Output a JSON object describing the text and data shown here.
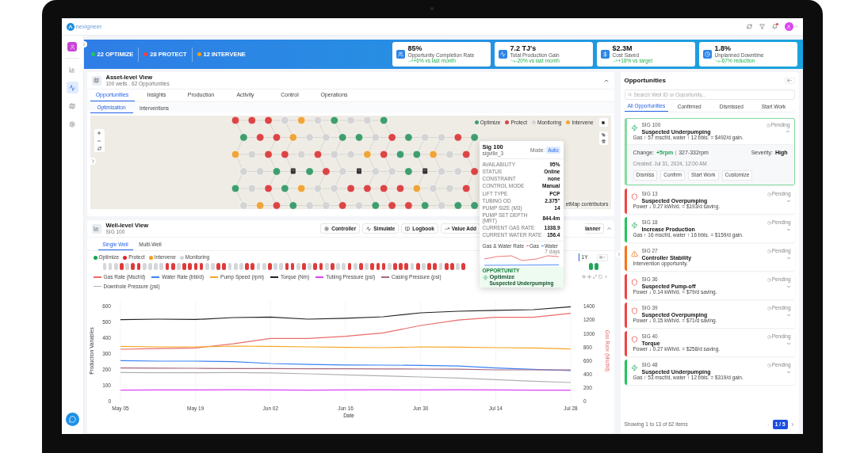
{
  "header": {
    "logo": "nexigneer",
    "unread": true
  },
  "sidebar": {
    "items": [
      {
        "selected": false
      },
      {
        "selected": true
      },
      {
        "selected": false
      },
      {
        "selected": false
      }
    ]
  },
  "banner": {
    "counts": [
      {
        "label": "22 OPTIMIZE",
        "color": "#22c55e"
      },
      {
        "label": "28 PROTECT",
        "color": "#ef4444"
      },
      {
        "label": "12 INTERVENE",
        "color": "#f59e0b"
      }
    ],
    "kpis": [
      {
        "value": "85%",
        "label": "Opportunity Completion Rate",
        "trend": "+6% vs last month",
        "rising": true
      },
      {
        "value": "7.2 TJ's",
        "label": "Total Production Gain",
        "trend": "-20% vs last month",
        "rising": false
      },
      {
        "value": "$2.3M",
        "label": "Cost Saved",
        "trend": "+18% vs target",
        "rising": true
      },
      {
        "value": "1.8%",
        "label": "Unplanned Downtime",
        "trend": "-67% reduction",
        "rising": false
      }
    ]
  },
  "asset_view": {
    "title": "Asset-level View",
    "subtitle": "100 wells . 62 Opportunities",
    "expanded": true,
    "tabs": [
      {
        "label": "Opportunities",
        "selected": true
      },
      {
        "label": "Insights",
        "selected": false
      },
      {
        "label": "Production",
        "selected": false
      },
      {
        "label": "Activity",
        "selected": false
      },
      {
        "label": "Control",
        "selected": false
      },
      {
        "label": "Operations",
        "selected": false
      }
    ],
    "subtabs": [
      {
        "label": "Optimisation",
        "selected": true
      },
      {
        "label": "Interventions",
        "selected": false
      }
    ],
    "map": {
      "legend": [
        {
          "label": "Optimize",
          "color": "#3f9e6e"
        },
        {
          "label": "Protect",
          "color": "#dc4545"
        },
        {
          "label": "Monitoring",
          "color": "#d4d4d4"
        },
        {
          "label": "Intervene",
          "color": "#f0a53a"
        }
      ],
      "rows": [
        {
          "nodes": [
            {
              "kind": "protect"
            },
            {
              "kind": "protect"
            },
            {
              "kind": "protect"
            },
            {
              "kind": "monitoring"
            },
            {
              "kind": "intervene"
            },
            {
              "kind": "monitoring"
            },
            {
              "kind": "optimize"
            },
            {
              "kind": "monitoring"
            },
            {
              "kind": "monitoring"
            },
            {
              "kind": "optimize"
            }
          ]
        },
        {
          "nodes": [
            {
              "kind": "optimize"
            },
            {
              "kind": "protect"
            },
            {
              "kind": "protect"
            },
            {
              "kind": "intervene"
            },
            {
              "kind": "monitoring"
            },
            {
              "kind": "monitoring"
            },
            {
              "kind": "optimize"
            },
            {
              "kind": "optimize"
            },
            {
              "kind": "monitoring"
            },
            {
              "kind": "protect"
            },
            {
              "kind": "optimize"
            },
            {
              "kind": "monitoring"
            },
            {
              "kind": "monitoring"
            },
            {
              "kind": "protect"
            },
            {
              "kind": "optimize"
            }
          ]
        },
        {
          "nodes": [
            {
              "kind": "intervene"
            },
            {
              "kind": "monitoring"
            },
            {
              "kind": "protect"
            },
            {
              "kind": "protect"
            },
            {
              "kind": "monitoring"
            },
            {
              "kind": "protect"
            },
            {
              "kind": "monitoring"
            },
            {
              "kind": "monitoring"
            },
            {
              "kind": "intervene"
            },
            {
              "kind": "protect"
            },
            {
              "kind": "optimize"
            },
            {
              "kind": "optimize"
            },
            {
              "kind": "intervene"
            },
            {
              "kind": "monitoring"
            },
            {
              "kind": "protect"
            }
          ]
        },
        {
          "nodes": [
            {
              "kind": "monitoring"
            },
            {
              "kind": "monitoring"
            },
            {
              "kind": "optimize"
            },
            {
              "kind": "pump"
            },
            {
              "kind": "optimize"
            },
            {
              "kind": "protect"
            },
            {
              "kind": "monitoring"
            },
            {
              "kind": "pump"
            },
            {
              "kind": "monitoring"
            },
            {
              "kind": "monitoring"
            },
            {
              "kind": "optimize"
            },
            {
              "kind": "pump"
            },
            {
              "kind": "monitoring"
            },
            {
              "kind": "monitoring"
            },
            {
              "kind": "protect"
            }
          ]
        },
        {
          "nodes": [
            {
              "kind": "optimize"
            },
            {
              "kind": "monitoring"
            },
            {
              "kind": "protect"
            },
            {
              "kind": "optimize"
            },
            {
              "kind": "intervene"
            },
            {
              "kind": "monitoring"
            },
            {
              "kind": "monitoring"
            },
            {
              "kind": "protect"
            },
            {
              "kind": "protect"
            },
            {
              "kind": "protect"
            },
            {
              "kind": "protect"
            },
            {
              "kind": "intervene"
            },
            {
              "kind": "monitoring"
            },
            {
              "kind": "monitoring"
            },
            {
              "kind": "protect"
            }
          ]
        },
        {
          "nodes": [
            {
              "kind": "monitoring"
            },
            {
              "kind": "intervene"
            },
            {
              "kind": "protect"
            },
            {
              "kind": "optimize"
            },
            {
              "kind": "monitoring"
            },
            {
              "kind": "monitoring"
            },
            {
              "kind": "protect"
            },
            {
              "kind": "monitoring"
            },
            {
              "kind": "optimize"
            },
            {
              "kind": "protect"
            },
            {
              "kind": "protect"
            },
            {
              "kind": "optimize"
            },
            {
              "kind": "monitoring"
            },
            {
              "kind": "optimize"
            },
            {
              "kind": "optimize"
            }
          ]
        }
      ],
      "attribution": "etMap contributors"
    }
  },
  "well_view": {
    "title": "Well-level View",
    "subtitle": "SIG 100",
    "expanded": true,
    "actions": [
      "Controller",
      "Simulate",
      "Logbook",
      "Value Add"
    ],
    "cut_action": "lanner",
    "tabs": [
      {
        "label": "Single Well",
        "selected": true
      },
      {
        "label": "Multi-Well",
        "selected": false
      }
    ],
    "status_legend": [
      {
        "label": "Optimize",
        "color": "#16a34a"
      },
      {
        "label": "Protect",
        "color": "#dc2626"
      },
      {
        "label": "Intervene",
        "color": "#f59e0b"
      },
      {
        "label": "Monitoring",
        "color": "#d1d5db"
      }
    ],
    "range": "1Y",
    "pills": [
      {
        "kind": "monitoring"
      },
      {
        "kind": "monitoring"
      },
      {
        "kind": "monitoring"
      },
      {
        "kind": "protect"
      },
      {
        "kind": "monitoring"
      },
      {
        "kind": "protect"
      },
      {
        "kind": "protect"
      },
      {
        "kind": "monitoring"
      },
      {
        "kind": "monitoring"
      },
      {
        "kind": "monitoring"
      },
      {
        "kind": "monitoring"
      },
      {
        "kind": "protect"
      },
      {
        "kind": "protect"
      },
      {
        "kind": "monitoring"
      },
      {
        "kind": "protect"
      },
      {
        "kind": "protect"
      },
      {
        "kind": "protect"
      },
      {
        "kind": "protect"
      },
      {
        "kind": "monitoring"
      },
      {
        "kind": "monitoring"
      },
      {
        "kind": "protect"
      },
      {
        "kind": "protect"
      },
      {
        "kind": "monitoring"
      },
      {
        "kind": "monitoring"
      },
      {
        "kind": "monitoring"
      },
      {
        "kind": "protect"
      },
      {
        "kind": "protect"
      },
      {
        "kind": "monitoring"
      },
      {
        "kind": "monitoring"
      },
      {
        "kind": "protect"
      },
      {
        "kind": "monitoring"
      },
      {
        "kind": "monitoring"
      },
      {
        "kind": "protect"
      },
      {
        "kind": "protect"
      },
      {
        "kind": "monitoring"
      },
      {
        "kind": "protect"
      },
      {
        "kind": "monitoring"
      },
      {
        "kind": "protect"
      },
      {
        "kind": "protect"
      },
      {
        "kind": "monitoring"
      },
      {
        "kind": "protect"
      },
      {
        "kind": "monitoring"
      },
      {
        "kind": "monitoring"
      },
      {
        "kind": "protect"
      },
      {
        "kind": "monitoring"
      },
      {
        "kind": "protect"
      },
      {
        "kind": "monitoring"
      },
      {
        "kind": "protect"
      },
      {
        "kind": "protect"
      },
      {
        "kind": "protect"
      },
      {
        "kind": "monitoring"
      },
      {
        "kind": "protect"
      },
      {
        "kind": "protect"
      },
      {
        "kind": "protect"
      },
      {
        "kind": "monitoring"
      },
      {
        "kind": "protect"
      },
      {
        "kind": "monitoring"
      },
      {
        "kind": "protect"
      },
      {
        "kind": "protect"
      },
      {
        "kind": "monitoring"
      },
      {
        "kind": "protect"
      },
      {
        "kind": "protect"
      },
      {
        "kind": "monitoring"
      },
      {
        "kind": "protect"
      }
    ],
    "pills_after": [
      {
        "kind": "optimize"
      },
      {
        "kind": "optimize"
      }
    ],
    "chart_data": {
      "type": "line",
      "grid": true,
      "xlabel": "Date",
      "ylabel": "Production Variables",
      "y2label": "Gas Rate (Mscf/d)",
      "categories": [
        "May 05",
        null,
        "May 19",
        null,
        "Jun 02",
        null,
        "Jun 16",
        null,
        "Jun 30",
        null,
        "Jul 14",
        null,
        "Jul 28"
      ],
      "ylim": [
        0,
        600
      ],
      "yticks": [
        0,
        100,
        200,
        300,
        400,
        500,
        600
      ],
      "y2lim": [
        0,
        1400
      ],
      "y2ticks": [
        0,
        200,
        400,
        600,
        800,
        1000,
        1200,
        1400
      ],
      "series": [
        {
          "name": "Gas Rate (Mscf/d)",
          "color": "#e96b6b",
          "axis": "y2",
          "values": [
            770,
            780,
            790,
            850,
            930,
            930,
            960,
            1010,
            1120,
            1200,
            1240,
            1240,
            1300
          ]
        },
        {
          "name": "Water Rate (bbl/d)",
          "color": "#3b82f6",
          "values": [
            258,
            255,
            255,
            252,
            240,
            234,
            231,
            230,
            228,
            224,
            212,
            203,
            195
          ]
        },
        {
          "name": "Pump Speed (rpm)",
          "color": "#f5a623",
          "values": [
            348,
            345,
            345,
            350,
            348,
            345,
            342,
            340,
            345,
            343,
            340,
            338,
            332
          ]
        },
        {
          "name": "Torque (Nm)",
          "color": "#222222",
          "values": [
            517,
            520,
            518,
            530,
            533,
            520,
            526,
            535,
            560,
            570,
            576,
            580,
            598
          ]
        },
        {
          "name": "Tubing Pressure (psi)",
          "color": "#e040fb",
          "values": [
            72,
            73,
            73,
            74,
            73,
            72,
            73,
            74,
            73,
            74,
            73,
            72,
            72
          ]
        },
        {
          "name": "Casing Pressure (psi)",
          "color": "#a86480",
          "values": [
            212,
            211,
            210,
            208,
            208,
            207,
            207,
            206,
            205,
            204,
            200,
            200,
            199
          ]
        },
        {
          "name": "Downhole Pressure (psi)",
          "color": "#b0b0b0",
          "values": [
            183,
            182,
            182,
            183,
            181,
            175,
            168,
            162,
            155,
            148,
            138,
            128,
            120
          ]
        }
      ]
    }
  },
  "popup": {
    "title": "Sig 100",
    "subtitle": "sigville_3",
    "mode_label": "Mode:",
    "mode": "Auto",
    "fields": [
      {
        "label": "AVAILABILITY",
        "value": "95%"
      },
      {
        "label": "STATUS",
        "value": "Online"
      },
      {
        "label": "CONSTRAINT",
        "value": "none"
      },
      {
        "label": "CONTROL MODE",
        "value": "Manual"
      },
      {
        "label": "LIFT TYPE",
        "value": "PCP"
      },
      {
        "label": "TUBING OD",
        "value": "2.375\""
      },
      {
        "label": "PUMP SIZE (M3)",
        "value": "14"
      },
      {
        "label": "PUMP SET DEPTH (MRT)",
        "value": "844.4m"
      },
      {
        "label": "CURRENT GAS RATE",
        "value": "1338.9"
      },
      {
        "label": "CURRENT WATER RATE",
        "value": "156.4"
      }
    ],
    "sparkline_title": "Gas & Water Rate",
    "sparkline_legend": [
      {
        "label": "Gas",
        "color": "#e96b6b"
      },
      {
        "label": "Water",
        "color": "#3b82f6"
      }
    ],
    "sparkline_range": "7 days",
    "opportunity_label": "OPPORTUNITY",
    "opportunity": "Optimize",
    "opportunity_detail": "Suspected Underpumping"
  },
  "opportunities": {
    "title": "Opportunities",
    "search": {
      "placeholder": "Search Well ID or Opportunity..."
    },
    "tabs": [
      {
        "label": "All Opportunities",
        "selected": true
      },
      {
        "label": "Confirmed",
        "selected": false
      },
      {
        "label": "Dismissed",
        "selected": false
      },
      {
        "label": "Start Work",
        "selected": false
      }
    ],
    "items": [
      {
        "sig": "SIG 100",
        "title": "Suspected Underpumping",
        "detail": "Gas ↑ 57 mscf/d, water ↑ 12 bbls. = $492/d gain.",
        "kind": "optimize",
        "status": "Pending",
        "expanded": true,
        "change_label": "Change:",
        "change": "+5rpm",
        "range": "327-332rpm",
        "severity_label": "Severity:",
        "severity": "High",
        "created": "Created: Jul 31, 2024, 12:00 AM",
        "actions": [
          "Dismiss",
          "Confirm",
          "Start Work",
          "Customize"
        ]
      },
      {
        "sig": "SIG 13",
        "title": "Suspected Overpumping",
        "detail": "Power ↓ 0.27 kWh/d. = $193/d saving.",
        "kind": "protect",
        "status": "Pending",
        "expanded": false
      },
      {
        "sig": "SIG 18",
        "title": "Increase Production",
        "detail": "Gas ↑ 16 mscf/d, water ↑ 16 bbls. = $159/d gain.",
        "kind": "optimize",
        "status": "Pending",
        "expanded": false
      },
      {
        "sig": "SIG 27",
        "title": "Controller Stability",
        "detail": "Intervention opportunity.",
        "kind": "intervene",
        "status": "Pending",
        "expanded": false
      },
      {
        "sig": "SIG 36",
        "title": "Suspected Pump-off",
        "detail": "Power ↓ 0.14 kWh/d. = $79/d saving.",
        "kind": "protect",
        "status": "Pending",
        "expanded": false
      },
      {
        "sig": "SIG 39",
        "title": "Suspected Overpumping",
        "detail": "Power ↓ 0.15 kWh/d. = $71/d saving.",
        "kind": "protect",
        "status": "Pending",
        "expanded": false
      },
      {
        "sig": "SIG 40",
        "title": "Torque",
        "detail": "Power ↓ 0.27 kWh/d. = $258/d saving.",
        "kind": "protect",
        "status": "Pending",
        "expanded": false
      },
      {
        "sig": "SIG 48",
        "title": "Suspected Underpumping",
        "detail": "Gas ↑ 53 mscf/d, water ↑ 12 bbls. = $319/d gain.",
        "kind": "optimize",
        "status": "Pending",
        "expanded": false
      }
    ],
    "footer": "Showing 1 to 13 of 62 items",
    "page": "1 / 5"
  }
}
